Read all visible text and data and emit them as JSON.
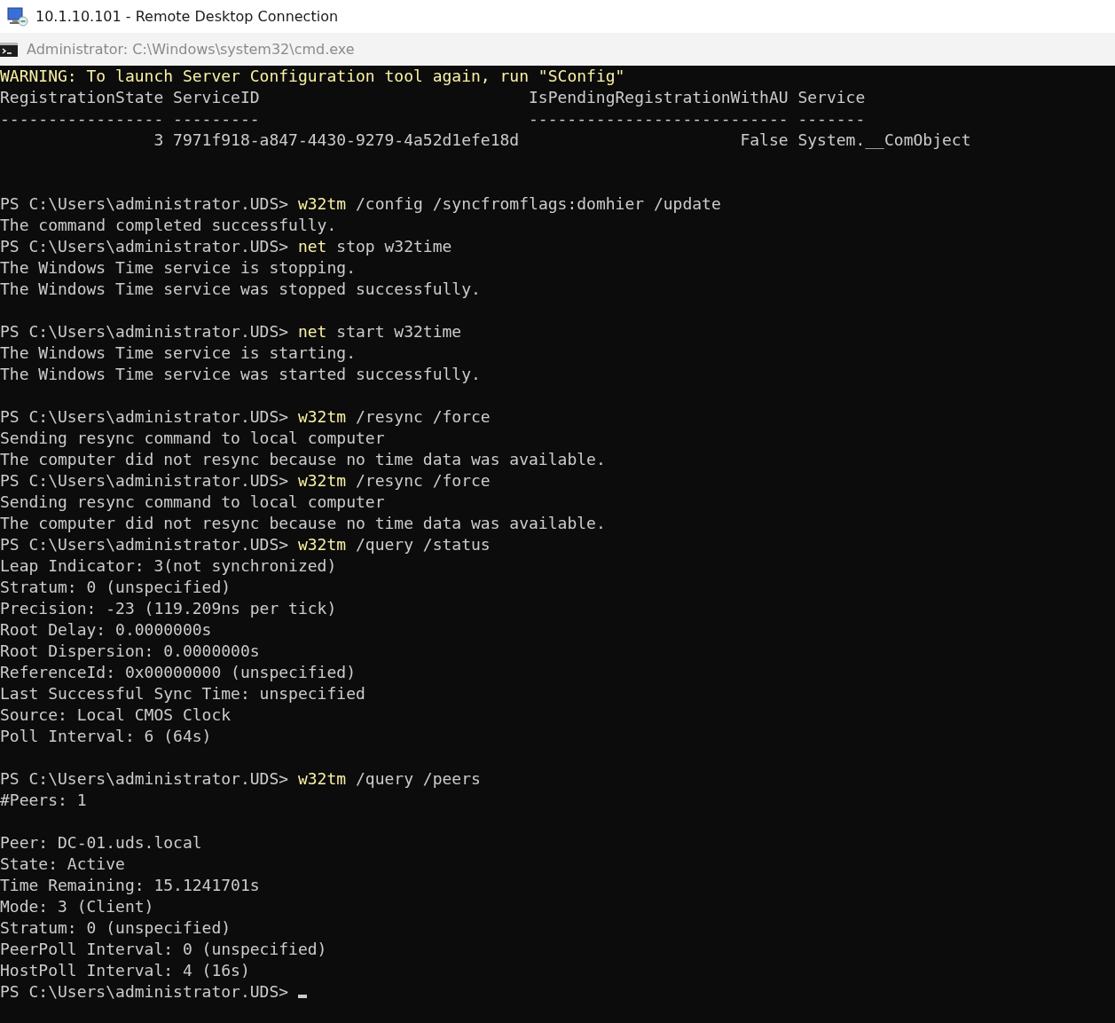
{
  "window": {
    "title": "10.1.10.101 - Remote Desktop Connection"
  },
  "console": {
    "title": "Administrator: C:\\Windows\\system32\\cmd.exe",
    "lines": [
      {
        "kind": "warning",
        "text": "WARNING: To launch Server Configuration tool again, run \"SConfig\""
      },
      {
        "kind": "table",
        "columns": [
          {
            "label": "RegistrationState",
            "rule": "-----------------",
            "kind": "numeric"
          },
          {
            "label": "ServiceID",
            "rule": "---------",
            "kind": "text"
          },
          {
            "label": "IsPendingRegistrationWithAU",
            "rule": "---------------------------",
            "kind": "numeric"
          },
          {
            "label": "Service",
            "rule": "-------",
            "kind": "text"
          }
        ],
        "rows": [
          [
            "3",
            "7971f918-a847-4430-9279-4a52d1efe18d",
            "False",
            "System.__ComObject"
          ]
        ]
      },
      {
        "kind": "blank"
      },
      {
        "kind": "blank"
      },
      {
        "kind": "prompt",
        "prompt": "PS C:\\Users\\administrator.UDS>",
        "command": "w32tm",
        "args": "/config /syncfromflags:domhier /update"
      },
      {
        "kind": "output",
        "text": "The command completed successfully."
      },
      {
        "kind": "prompt",
        "prompt": "PS C:\\Users\\administrator.UDS>",
        "command": "net",
        "args": "stop w32time"
      },
      {
        "kind": "output",
        "text": "The Windows Time service is stopping."
      },
      {
        "kind": "output",
        "text": "The Windows Time service was stopped successfully."
      },
      {
        "kind": "blank"
      },
      {
        "kind": "prompt",
        "prompt": "PS C:\\Users\\administrator.UDS>",
        "command": "net",
        "args": "start w32time"
      },
      {
        "kind": "output",
        "text": "The Windows Time service is starting."
      },
      {
        "kind": "output",
        "text": "The Windows Time service was started successfully."
      },
      {
        "kind": "blank"
      },
      {
        "kind": "prompt",
        "prompt": "PS C:\\Users\\administrator.UDS>",
        "command": "w32tm",
        "args": "/resync /force"
      },
      {
        "kind": "output",
        "text": "Sending resync command to local computer"
      },
      {
        "kind": "output",
        "text": "The computer did not resync because no time data was available."
      },
      {
        "kind": "prompt",
        "prompt": "PS C:\\Users\\administrator.UDS>",
        "command": "w32tm",
        "args": "/resync /force"
      },
      {
        "kind": "output",
        "text": "Sending resync command to local computer"
      },
      {
        "kind": "output",
        "text": "The computer did not resync because no time data was available."
      },
      {
        "kind": "prompt",
        "prompt": "PS C:\\Users\\administrator.UDS>",
        "command": "w32tm",
        "args": "/query /status"
      },
      {
        "kind": "output",
        "text": "Leap Indicator: 3(not synchronized)"
      },
      {
        "kind": "output",
        "text": "Stratum: 0 (unspecified)"
      },
      {
        "kind": "output",
        "text": "Precision: -23 (119.209ns per tick)"
      },
      {
        "kind": "output",
        "text": "Root Delay: 0.0000000s"
      },
      {
        "kind": "output",
        "text": "Root Dispersion: 0.0000000s"
      },
      {
        "kind": "output",
        "text": "ReferenceId: 0x00000000 (unspecified)"
      },
      {
        "kind": "output",
        "text": "Last Successful Sync Time: unspecified"
      },
      {
        "kind": "output",
        "text": "Source: Local CMOS Clock"
      },
      {
        "kind": "output",
        "text": "Poll Interval: 6 (64s)"
      },
      {
        "kind": "blank"
      },
      {
        "kind": "prompt",
        "prompt": "PS C:\\Users\\administrator.UDS>",
        "command": "w32tm",
        "args": "/query /peers"
      },
      {
        "kind": "output",
        "text": "#Peers: 1"
      },
      {
        "kind": "blank"
      },
      {
        "kind": "output",
        "text": "Peer: DC-01.uds.local"
      },
      {
        "kind": "output",
        "text": "State: Active"
      },
      {
        "kind": "output",
        "text": "Time Remaining: 15.1241701s"
      },
      {
        "kind": "output",
        "text": "Mode: 3 (Client)"
      },
      {
        "kind": "output",
        "text": "Stratum: 0 (unspecified)"
      },
      {
        "kind": "output",
        "text": "PeerPoll Interval: 0 (unspecified)"
      },
      {
        "kind": "output",
        "text": "HostPoll Interval: 4 (16s)"
      },
      {
        "kind": "prompt",
        "prompt": "PS C:\\Users\\administrator.UDS>",
        "cursor": true
      }
    ]
  }
}
